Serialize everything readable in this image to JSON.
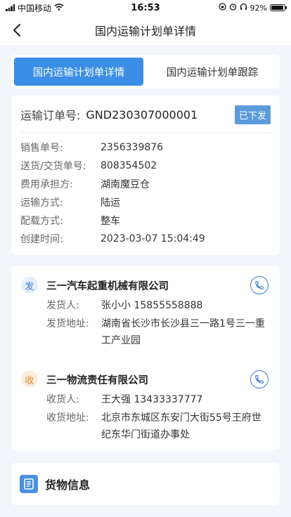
{
  "status_bar": {
    "carrier": "中国移动",
    "time": "16:53",
    "battery": "92%",
    "battery_level": 0.92
  },
  "nav": {
    "title": "国内运输计划单详情"
  },
  "tabs": [
    {
      "label": "国内运输计划单详情",
      "active": true
    },
    {
      "label": "国内运输计划单跟踪",
      "active": false
    }
  ],
  "order": {
    "label": "运输订单号:",
    "number": "GND230307000001",
    "status": "已下发",
    "fields": [
      {
        "key": "销售单号:",
        "value": "2356339876"
      },
      {
        "key": "送货/交货单号:",
        "value": "808354502"
      },
      {
        "key": "费用承担方:",
        "value": "湖南魔豆仓"
      },
      {
        "key": "运输方式:",
        "value": "陆运"
      },
      {
        "key": "配载方式:",
        "value": "整车"
      },
      {
        "key": "创建时间:",
        "value": "2023-03-07 15:04:49"
      }
    ]
  },
  "sender": {
    "badge": "发",
    "company": "三一汽车起重机械有限公司",
    "contact_label": "发货人:",
    "contact": "张小小 15855558888",
    "address_label": "发货地址:",
    "address": "湖南省长沙市长沙县三一路1号三一重工产业园"
  },
  "receiver": {
    "badge": "收",
    "company": "三一物流责任有限公司",
    "contact_label": "收货人:",
    "contact": "王大强 13433337777",
    "address_label": "收货地址:",
    "address": "北京市东城区东安门大街55号王府世纪东华门街道办事处"
  },
  "goods": {
    "title": "货物信息"
  },
  "icons": {
    "back": "chevron-left-icon",
    "phone": "phone-icon",
    "goods": "document-icon"
  },
  "colors": {
    "accent": "#3a8ee6",
    "status_badge": "#5b9bdc",
    "send": "#3a7dd6",
    "receive": "#e08a2a"
  }
}
